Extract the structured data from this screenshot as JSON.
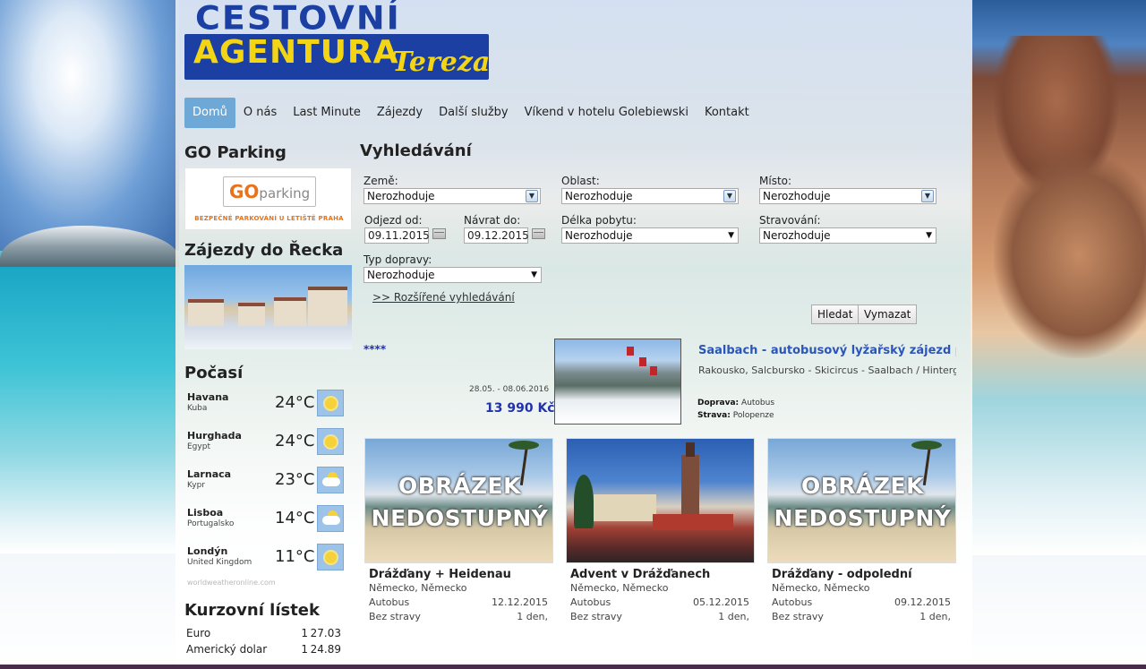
{
  "logo": {
    "line1": "CESTOVNÍ",
    "line2": "AGENTURA",
    "script": "Tereza"
  },
  "nav": [
    "Domů",
    "O nás",
    "Last Minute",
    "Zájezdy",
    "Další služby",
    "Víkend v hotelu Golebiewski",
    "Kontakt"
  ],
  "sidebar": {
    "parking_title": "GO Parking",
    "parking_banner": {
      "logo_go": "GO",
      "logo_rest": "parking",
      "tagline": "BEZPEČNÉ PARKOVÁNÍ U LETIŠTĚ PRAHA"
    },
    "greece_title": "Zájezdy do Řecka",
    "weather_title": "Počasí",
    "weather": [
      {
        "city": "Havana",
        "country": "Kuba",
        "temp": "24°C",
        "icon": "sun-icon"
      },
      {
        "city": "Hurghada",
        "country": "Egypt",
        "temp": "24°C",
        "icon": "sun-icon"
      },
      {
        "city": "Larnaca",
        "country": "Kypr",
        "temp": "23°C",
        "icon": "partly-cloudy-icon"
      },
      {
        "city": "Lisboa",
        "country": "Portugalsko",
        "temp": "14°C",
        "icon": "partly-cloudy-icon"
      },
      {
        "city": "Londýn",
        "country": "United Kingdom",
        "temp": "11°C",
        "icon": "sun-icon"
      }
    ],
    "weather_source": "worldweatheronline.com",
    "rates_title": "Kurzovní lístek",
    "rates": [
      {
        "name": "Euro",
        "amount": "1",
        "value": "27.03"
      },
      {
        "name": "Americký dolar",
        "amount": "1",
        "value": "24.89"
      }
    ]
  },
  "search": {
    "title": "Vyhledávání",
    "country_label": "Země:",
    "country_value": "Nerozhoduje",
    "area_label": "Oblast:",
    "area_value": "Nerozhoduje",
    "place_label": "Místo:",
    "place_value": "Nerozhoduje",
    "depart_label": "Odjezd od:",
    "depart_value": "09.11.2015",
    "return_label": "Návrat do:",
    "return_value": "09.12.2015",
    "length_label": "Délka pobytu:",
    "length_value": "Nerozhoduje",
    "board_label": "Stravování:",
    "board_value": "Nerozhoduje",
    "transport_label": "Typ dopravy:",
    "transport_value": "Nerozhoduje",
    "advanced_link": ">> Rozšířené vyhledávání",
    "search_button": "Hledat",
    "clear_button": "Vymazat"
  },
  "featured": {
    "stars": "****",
    "dates": "28.05. - 08.06.2016",
    "price": "13 990 Kč",
    "title": "Saalbach - autobusový lyžařský zájezd prosinec",
    "location": "Rakousko, Salcbursko - Skicircus - Saalbach / Hinterglemm",
    "transport_label": "Doprava:",
    "transport_value": "Autobus",
    "board_label": "Strava:",
    "board_value": "Polopenze"
  },
  "cards": [
    {
      "image_text_1": "OBRÁZEK",
      "image_text_2": "NEDOSTUPNÝ",
      "title": "Drážďany + Heidenau",
      "countries": "Německo, Německo",
      "transport": "Autobus",
      "date": "12.12.2015",
      "board": "Bez stravy",
      "length": "1 den,"
    },
    {
      "image_text_1": "",
      "image_text_2": "",
      "title": "Advent v Drážďanech",
      "countries": "Německo, Německo",
      "transport": "Autobus",
      "date": "05.12.2015",
      "board": "Bez stravy",
      "length": "1 den,"
    },
    {
      "image_text_1": "OBRÁZEK",
      "image_text_2": "NEDOSTUPNÝ",
      "title": "Drážďany - odpolední",
      "countries": "Německo, Německo",
      "transport": "Autobus",
      "date": "09.12.2015",
      "board": "Bez stravy",
      "length": "1 den,"
    }
  ],
  "colors": {
    "brand_blue": "#1b3fa2",
    "brand_yellow": "#f3d514",
    "nav_active": "#6ea8d6",
    "link_blue": "#2c55b8"
  }
}
